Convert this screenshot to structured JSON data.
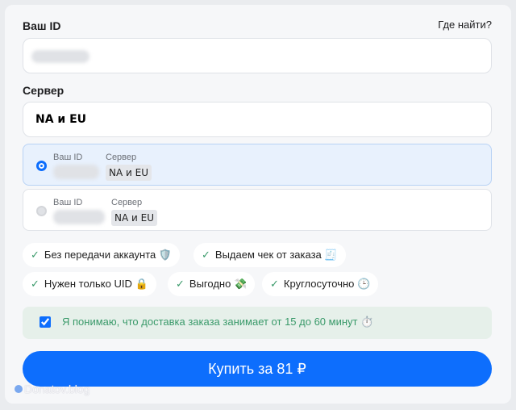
{
  "id_label": "Ваш ID",
  "where_find": "Где найти?",
  "server_label": "Сервер",
  "server_value": "NA  и  EU",
  "accounts": [
    {
      "id_label": "Ваш ID",
      "server_label": "Сервер",
      "server": "NA и EU",
      "selected": true
    },
    {
      "id_label": "Ваш ID",
      "server_label": "Сервер",
      "server": "NA и EU",
      "selected": false
    }
  ],
  "features": [
    {
      "text": "Без передачи аккаунта",
      "emoji": "🛡️"
    },
    {
      "text": "Выдаем чек от заказа",
      "emoji": "🧾"
    },
    {
      "text": "Нужен только UID",
      "emoji": "🔒"
    },
    {
      "text": "Выгодно",
      "emoji": "💸"
    },
    {
      "text": "Круглосуточно",
      "emoji": "🕒"
    }
  ],
  "check_icon": "✓",
  "agree_text": "Я понимаю, что доставка заказа занимает от 15 до 60 минут ⏱️",
  "agree_checked": true,
  "buy_label": "Купить за 81 ₽",
  "watermark": "Donatov.blog",
  "colors": {
    "accent": "#0d6efd",
    "success": "#3a9a6a"
  }
}
